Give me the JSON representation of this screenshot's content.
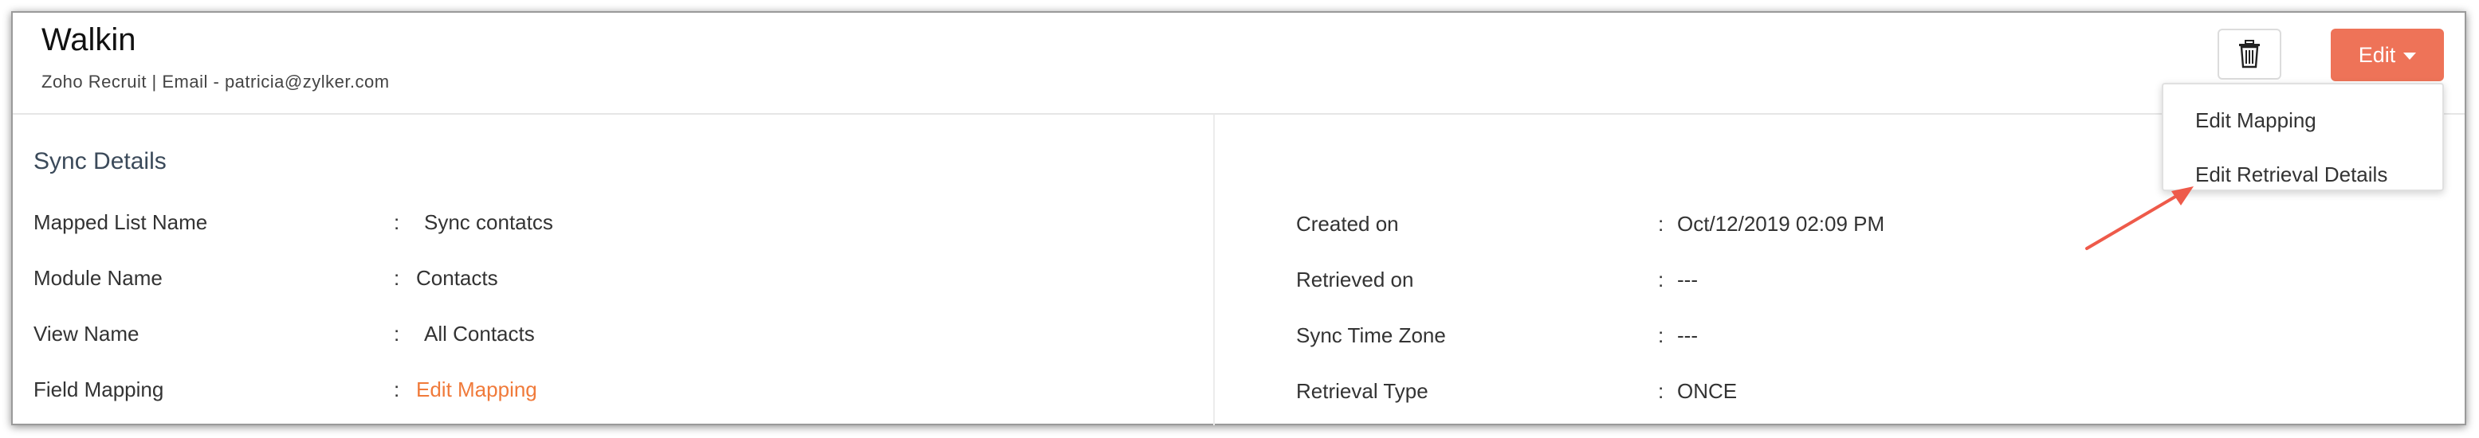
{
  "header": {
    "title": "Walkin",
    "subtitle": "Zoho Recruit | Email - patricia@zylker.com",
    "delete_icon": "trash-icon",
    "edit_label": "Edit",
    "edit_caret_icon": "caret-down-icon",
    "accent_color": "#ee7358"
  },
  "dropdown": {
    "items": [
      {
        "label": "Edit Mapping"
      },
      {
        "label": "Edit Retrieval Details"
      }
    ]
  },
  "section": {
    "title": "Sync Details"
  },
  "left_fields": [
    {
      "label": "Mapped List Name",
      "colon": ":",
      "value": "Sync contatcs"
    },
    {
      "label": "Module Name",
      "colon": ":",
      "value": "Contacts"
    },
    {
      "label": "View Name",
      "colon": ":",
      "value": "All Contacts"
    },
    {
      "label": "Field Mapping",
      "colon": ":",
      "value": "Edit Mapping"
    }
  ],
  "right_fields": [
    {
      "label": "Created on",
      "colon": ":",
      "value": "Oct/12/2019 02:09 PM"
    },
    {
      "label": "Retrieved on",
      "colon": ":",
      "value": "---"
    },
    {
      "label": "Sync Time Zone",
      "colon": ":",
      "value": "---"
    },
    {
      "label": "Retrieval Type",
      "colon": ":",
      "value": "ONCE"
    }
  ],
  "annotation": {
    "arrow_color": "#ee5a4a"
  }
}
